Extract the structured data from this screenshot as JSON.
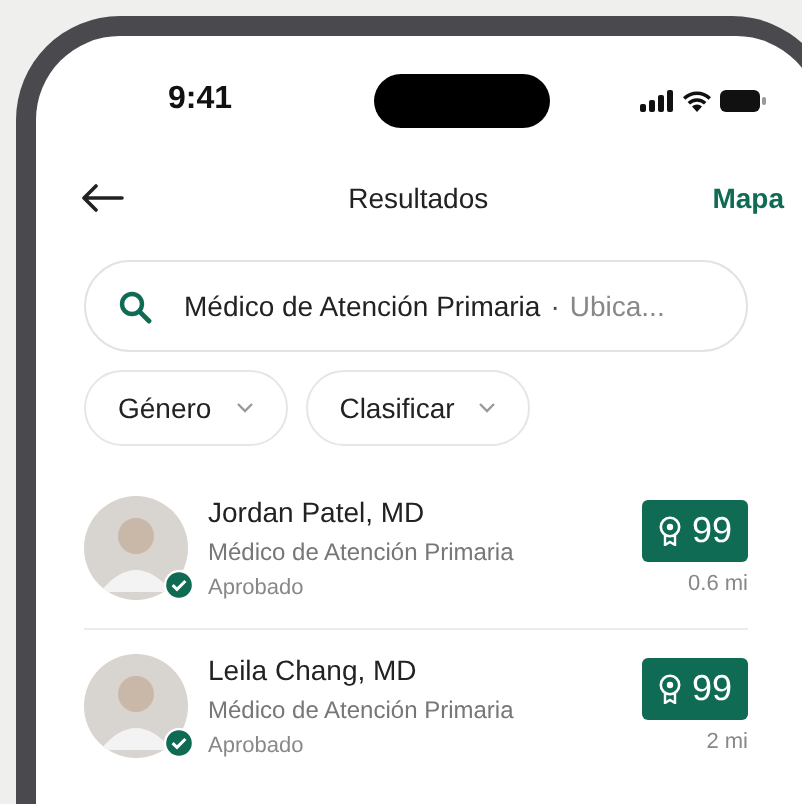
{
  "status_bar": {
    "time": "9:41"
  },
  "header": {
    "title": "Resultados",
    "action": "Mapa"
  },
  "search": {
    "value": "Médico de Atención Primaria",
    "separator": "·",
    "location_placeholder": "Ubica..."
  },
  "filters": [
    {
      "label": "Género"
    },
    {
      "label": "Clasificar"
    }
  ],
  "doctors": [
    {
      "name": "Jordan Patel, MD",
      "specialty": "Médico de Atención Primaria",
      "status": "Aprobado",
      "verified": true,
      "score": "99",
      "distance": "0.6 mi"
    },
    {
      "name": "Leila Chang, MD",
      "specialty": "Médico de Atención Primaria",
      "status": "Aprobado",
      "verified": true,
      "score": "99",
      "distance": "2 mi"
    }
  ]
}
